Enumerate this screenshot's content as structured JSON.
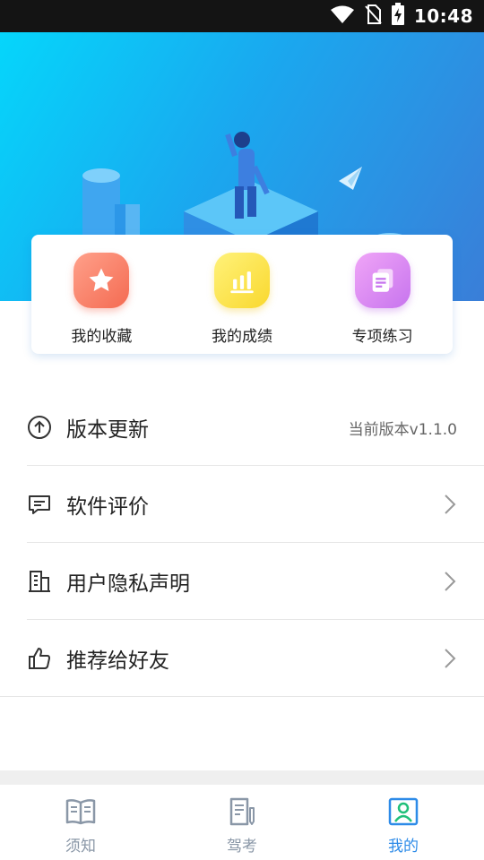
{
  "status_bar": {
    "time": "10:48",
    "icons": [
      "wifi-icon",
      "no-sim-icon",
      "battery-charging-icon"
    ]
  },
  "hero": {
    "illustration": "person-on-isometric-platform-with-paper-plane"
  },
  "quick_actions": [
    {
      "label": "我的收藏",
      "icon": "star-icon",
      "color": "#f46b52"
    },
    {
      "label": "我的成绩",
      "icon": "bar-chart-icon",
      "color": "#f9d82e"
    },
    {
      "label": "专项练习",
      "icon": "document-icon",
      "color": "#c774ee"
    }
  ],
  "menu": [
    {
      "label": "版本更新",
      "icon": "upload-circle-icon",
      "value": "当前版本v1.1.0"
    },
    {
      "label": "软件评价",
      "icon": "comment-icon"
    },
    {
      "label": "用户隐私声明",
      "icon": "building-icon"
    },
    {
      "label": "推荐给好友",
      "icon": "thumbs-up-icon"
    }
  ],
  "tabs": [
    {
      "label": "须知",
      "icon": "book-icon",
      "active": false
    },
    {
      "label": "驾考",
      "icon": "exam-paper-icon",
      "active": false
    },
    {
      "label": "我的",
      "icon": "profile-icon",
      "active": true
    }
  ],
  "colors": {
    "accent": "#2d8be8",
    "hero_start": "#05d6fb",
    "hero_end": "#3a7ed8",
    "tab_inactive": "#8a97a7"
  }
}
